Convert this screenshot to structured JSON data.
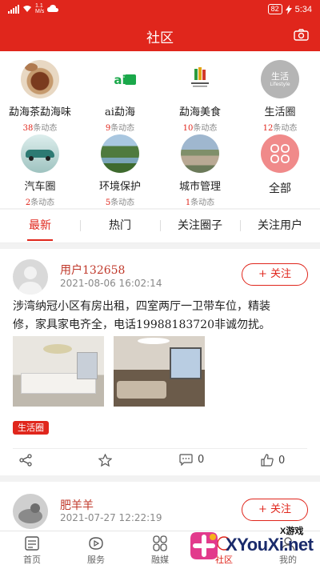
{
  "status_bar": {
    "network": "4G",
    "speed_top": "1.1",
    "speed_bottom": "M/s",
    "battery": "82",
    "time": "5:34"
  },
  "header": {
    "title": "社区",
    "camera_icon": "camera-icon"
  },
  "circles": [
    {
      "name": "勐海茶勐海味",
      "count": "38",
      "suffix": "条动态",
      "icon": "tea-photo"
    },
    {
      "name": "ai勐海",
      "count": "9",
      "suffix": "条动态",
      "icon": "ai-menghai-logo"
    },
    {
      "name": "勐海美食",
      "count": "10",
      "suffix": "条动态",
      "icon": "food-logo"
    },
    {
      "name": "生活圈",
      "count": "12",
      "suffix": "条动态",
      "icon": "life-circle-logo",
      "logo_text": "生活",
      "logo_sub": "Lifestyle"
    },
    {
      "name": "汽车圈",
      "count": "2",
      "suffix": "条动态",
      "icon": "car-photo"
    },
    {
      "name": "环境保护",
      "count": "5",
      "suffix": "条动态",
      "icon": "river-photo"
    },
    {
      "name": "城市管理",
      "count": "1",
      "suffix": "条动态",
      "icon": "city-photo"
    },
    {
      "name": "全部",
      "count": "",
      "suffix": "",
      "icon": "all-grid-icon"
    }
  ],
  "tabs": [
    "最新",
    "热门",
    "关注圈子",
    "关注用户"
  ],
  "active_tab": 0,
  "posts": [
    {
      "user": "用户132658",
      "time": "2021-08-06 16:02:14",
      "follow": "+ 关注",
      "text_line1": "涉湾纳冠小区有房出租，四室两厅一卫带车位，精装",
      "text_line2": "修，家具家电齐全，电话19988183720非诚勿扰。",
      "tag": "生活圈",
      "comments": "0",
      "likes": "0"
    },
    {
      "user": "肥羊羊",
      "time": "2021-07-27 12:22:19",
      "follow": "+ 关注"
    }
  ],
  "bottom_nav": [
    {
      "label": "首页",
      "icon": "home-icon"
    },
    {
      "label": "服务",
      "icon": "service-icon"
    },
    {
      "label": "融媒",
      "icon": "media-icon"
    },
    {
      "label": "社区",
      "icon": "community-icon"
    },
    {
      "label": "我的",
      "icon": "profile-icon"
    }
  ],
  "watermark": {
    "small": "X游戏",
    "big": "XYouXi.net"
  },
  "colors": {
    "brand_red": "#e0261c",
    "text_gray": "#888888"
  }
}
